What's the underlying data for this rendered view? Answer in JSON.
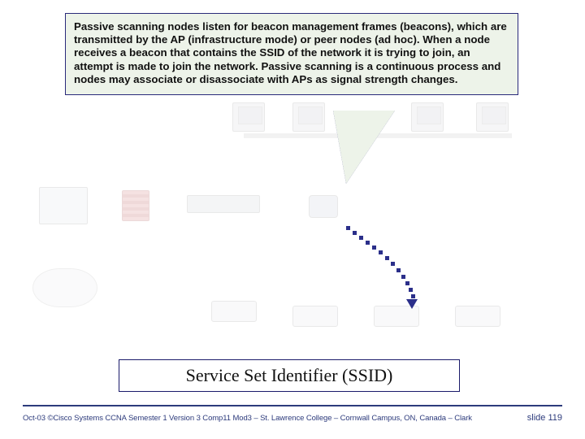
{
  "callout": {
    "text": "Passive scanning nodes listen for beacon management frames (beacons), which are transmitted by the AP (infrastructure mode) or peer nodes (ad hoc). When a node receives a beacon that contains the SSID of the network it is trying to join, an attempt is made to join the network. Passive scanning is a continuous process and nodes may associate or disassociate with APs as signal strength changes."
  },
  "title": "Service Set Identifier (SSID)",
  "footer": {
    "left": "Oct-03 ©Cisco Systems CCNA Semester 1 Version 3 Comp11 Mod3 – St. Lawrence College – Cornwall Campus, ON, Canada – Clark",
    "right": "slide 119"
  }
}
